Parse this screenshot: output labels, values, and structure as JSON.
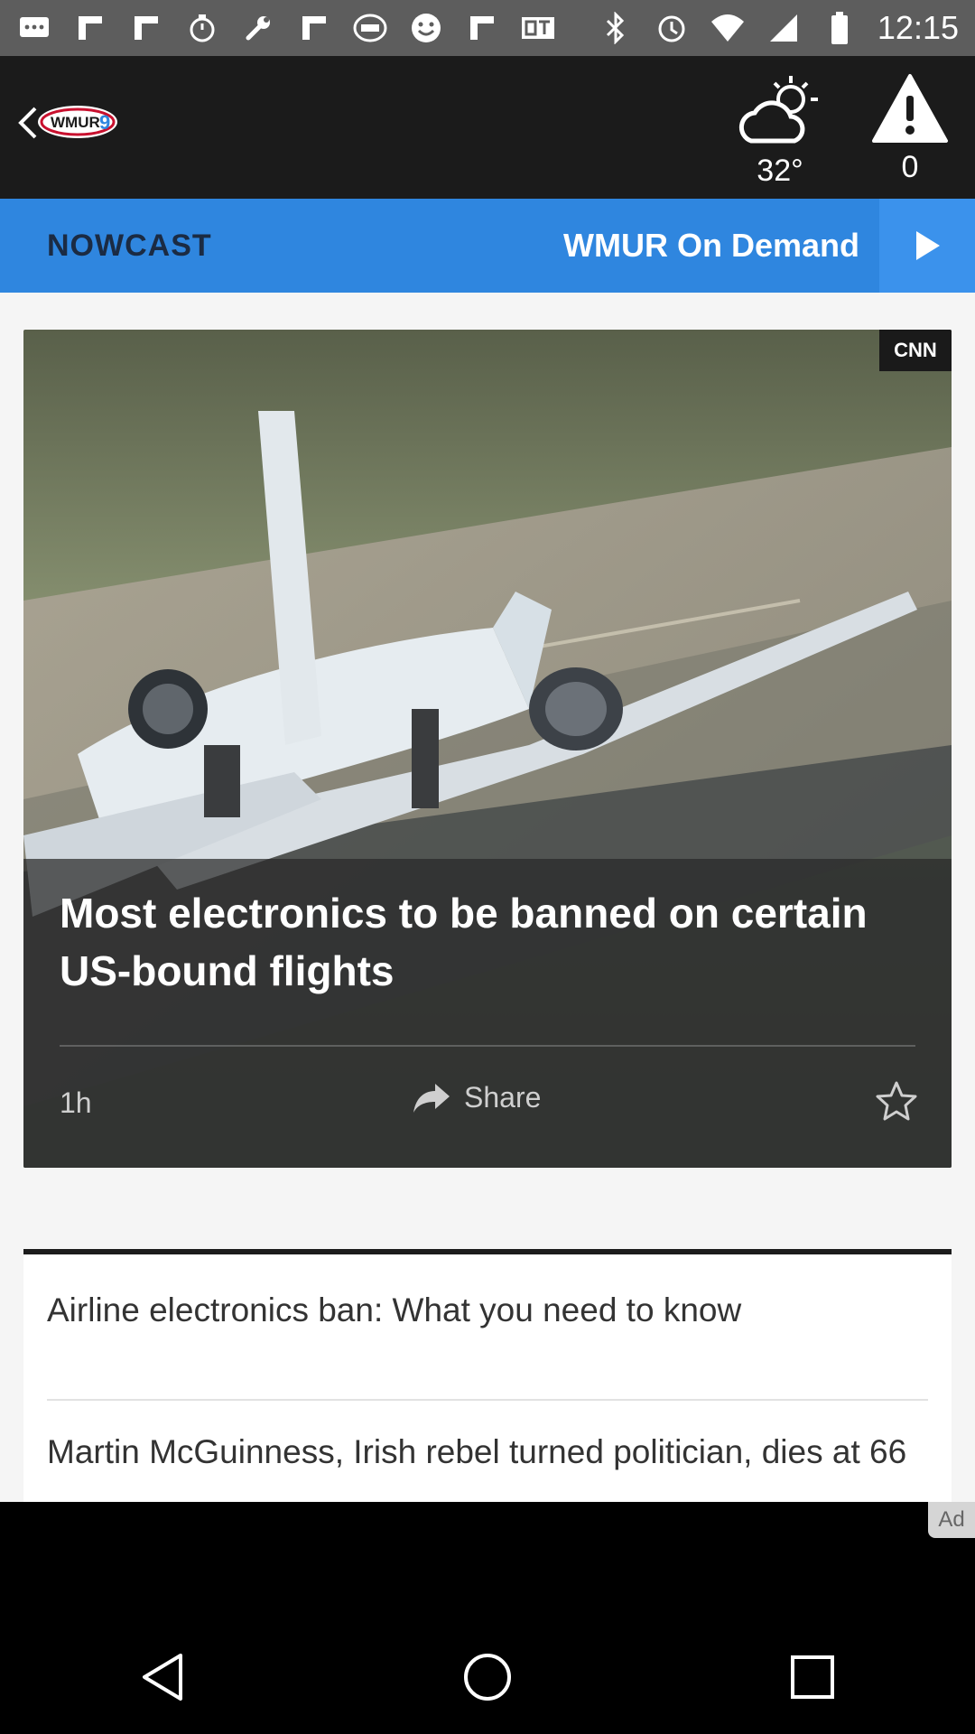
{
  "status_bar": {
    "time": "12:15",
    "icons": [
      "message-icon",
      "flipboard-icon",
      "flipboard-icon",
      "stopwatch-icon",
      "wrench-icon",
      "flipboard-icon",
      "fox-sports-icon",
      "smiley-icon",
      "flipboard-icon",
      "qt-icon",
      "bluetooth-icon",
      "alarm-icon",
      "wifi-icon",
      "signal-icon",
      "battery-icon"
    ]
  },
  "app_bar": {
    "logo_text": "WMUR9",
    "weather_temp": "32°",
    "alerts_count": "0"
  },
  "tabs": {
    "nowcast": "NOWCAST",
    "on_demand": "WMUR On Demand"
  },
  "hero": {
    "source_badge": "CNN",
    "title": "Most electronics to be banned on certain US-bound flights",
    "age": "1h",
    "share_label": "Share"
  },
  "related": {
    "items": [
      "Airline electronics ban: What you need to know",
      "Martin McGuinness, Irish rebel turned politician, dies at 66"
    ]
  },
  "ad": {
    "label": "Ad"
  },
  "colors": {
    "tab_blue": "#2f86df",
    "app_bar_bg": "#1b1b1b",
    "status_bar_bg": "#5d5d5d"
  }
}
